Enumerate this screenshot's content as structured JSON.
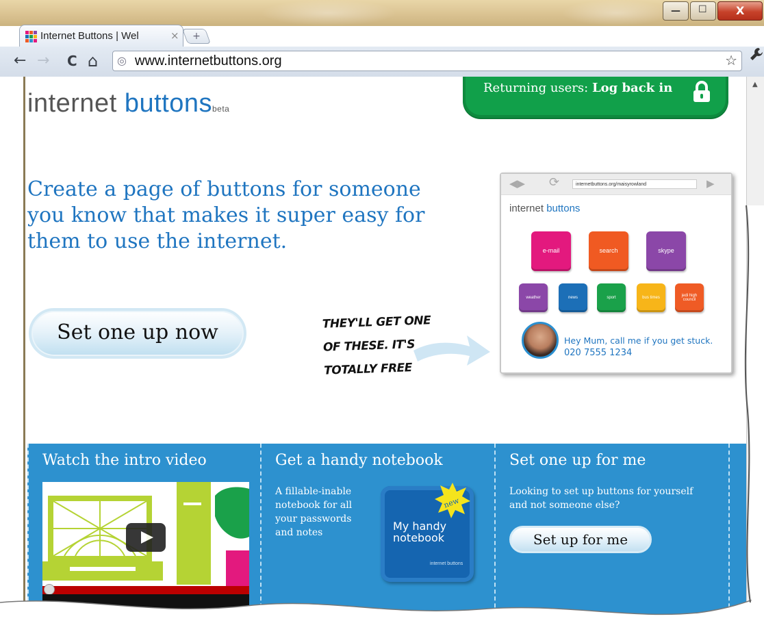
{
  "browser": {
    "tab_title": "Internet Buttons | Wel",
    "tab_close": "×",
    "new_tab": "+",
    "url": "www.internetbuttons.org",
    "back": "←",
    "forward": "→",
    "reload": "C",
    "home": "⌂",
    "star": "☆",
    "wrench": "🔧",
    "window_min": "—",
    "window_max": "☐",
    "window_close": "X"
  },
  "site": {
    "logo_part1": "internet ",
    "logo_part2": "buttons",
    "logo_beta": "beta",
    "login_prefix": "Returning users: ",
    "login_link": "Log back in",
    "headline": "Create a page of buttons for someone you know that makes it super easy for them to use the internet.",
    "cta": "Set one up now",
    "scribble_lines": [
      "They'll get one",
      "of these. It's",
      "totally free"
    ]
  },
  "preview": {
    "url": "internetbuttons.org/maisyrowland",
    "logo_part1": "internet ",
    "logo_part2": "buttons",
    "big_buttons": [
      {
        "label": "e-mail",
        "color": "#e3197e"
      },
      {
        "label": "search",
        "color": "#f05a22"
      },
      {
        "label": "skype",
        "color": "#8b47a8"
      }
    ],
    "small_buttons": [
      {
        "label": "weather",
        "color": "#8b47a8"
      },
      {
        "label": "news",
        "color": "#1c6fb7"
      },
      {
        "label": "sport",
        "color": "#1aa14a"
      },
      {
        "label": "bus times",
        "color": "#f7b519"
      },
      {
        "label": "jedi high council",
        "color": "#ef5b25"
      }
    ],
    "message": "Hey Mum, call me if you get stuck.",
    "phone": "020 7555 1234"
  },
  "columns": [
    {
      "title": "Watch the intro video"
    },
    {
      "title": "Get a handy notebook",
      "text": "A fillable-inable notebook for all your passwords and notes",
      "notebook_badge": "new",
      "notebook_title": "My handy notebook",
      "notebook_brand": "internet buttons"
    },
    {
      "title": "Set one up for me",
      "text": "Looking to set up buttons for yourself and not someone else?",
      "button": "Set up for me"
    }
  ],
  "colors": {
    "brand_blue": "#1f75c0",
    "section_blue": "#2d91cf",
    "login_green": "#11a04a"
  }
}
